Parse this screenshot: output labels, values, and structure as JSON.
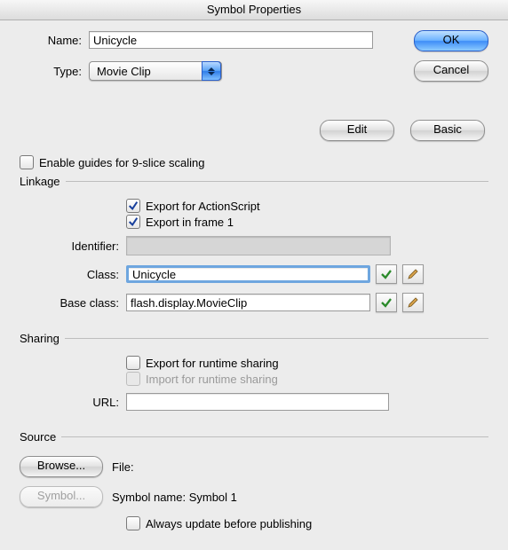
{
  "window": {
    "title": "Symbol Properties"
  },
  "buttons": {
    "ok": "OK",
    "cancel": "Cancel",
    "edit": "Edit",
    "basic": "Basic",
    "browse": "Browse...",
    "symbol": "Symbol..."
  },
  "labels": {
    "name": "Name:",
    "type": "Type:",
    "enable9slice": "Enable guides for 9-slice scaling",
    "exportAS": "Export for ActionScript",
    "exportFrame1": "Export in frame 1",
    "identifier": "Identifier:",
    "klass": "Class:",
    "baseClass": "Base class:",
    "exportRuntime": "Export for runtime sharing",
    "importRuntime": "Import for runtime sharing",
    "url": "URL:",
    "file": "File:",
    "symbolName": "Symbol name: Symbol 1",
    "alwaysUpdate": "Always update before publishing"
  },
  "groups": {
    "linkage": "Linkage",
    "sharing": "Sharing",
    "source": "Source"
  },
  "values": {
    "name": "Unicycle",
    "type": "Movie Clip",
    "identifier": "",
    "klass": "Unicycle",
    "baseClass": "flash.display.MovieClip",
    "url": ""
  },
  "checkboxes": {
    "enable9slice": false,
    "exportAS": true,
    "exportFrame1": true,
    "exportRuntime": false,
    "importRuntime": false,
    "alwaysUpdate": false
  }
}
